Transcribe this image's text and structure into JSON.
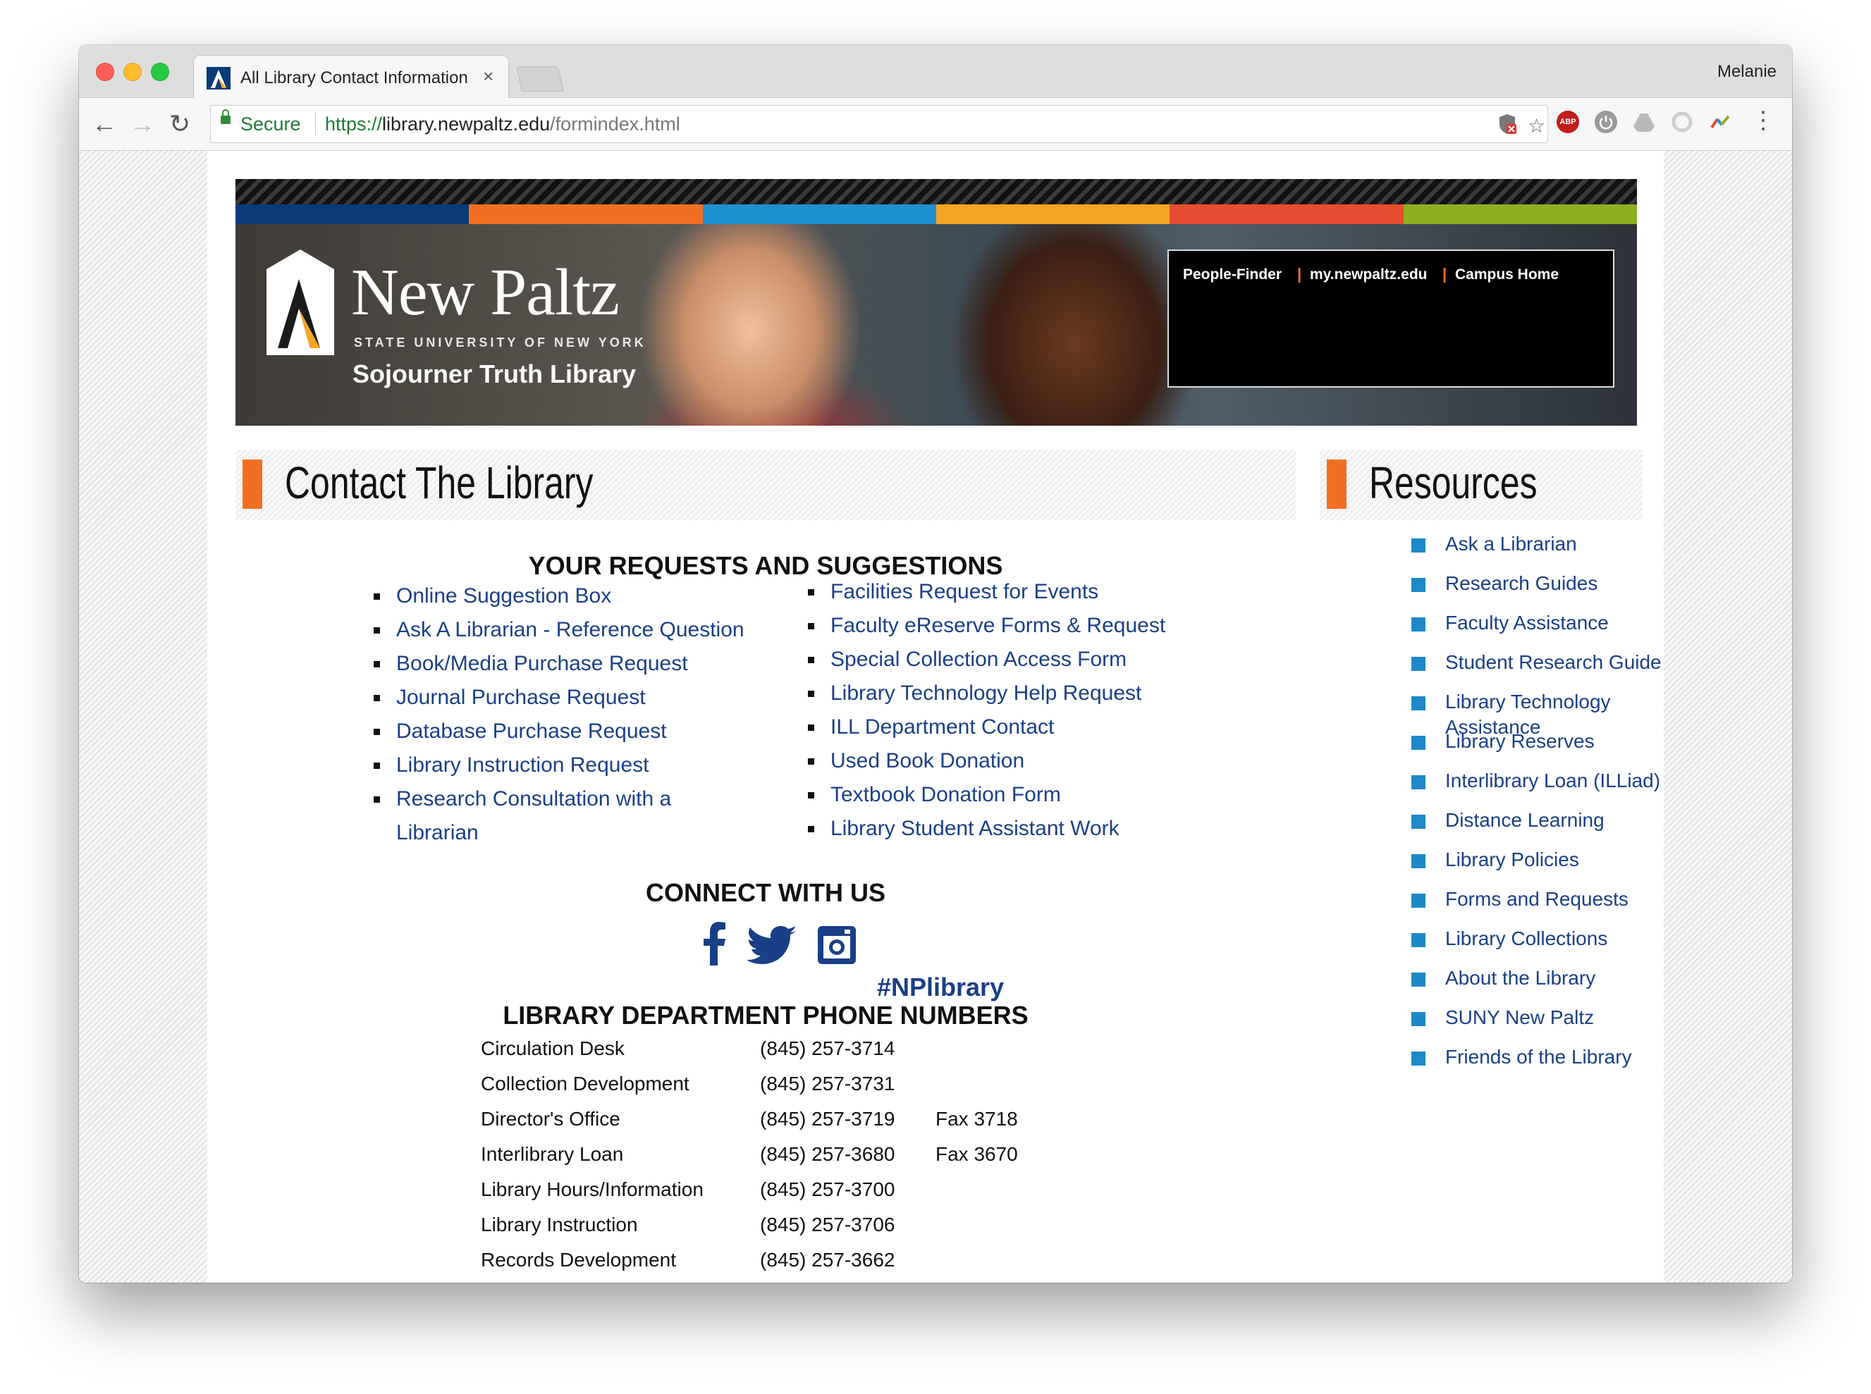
{
  "browser": {
    "tab_title": "All Library Contact Information",
    "tab_close": "×",
    "profile_name": "Melanie",
    "secure_label": "Secure",
    "url_scheme": "https://",
    "url_host": "library.newpaltz.edu",
    "url_path": "/formindex.html",
    "extensions": [
      "adblock-plus-icon",
      "power-icon",
      "drive-icon",
      "sync-icon",
      "color-picker-icon"
    ],
    "abp_label": "ABP"
  },
  "banner": {
    "logo_name": "New Paltz",
    "logo_sub": "STATE UNIVERSITY OF NEW YORK",
    "logo_library": "Sojourner Truth Library",
    "colors": [
      "#0b3a78",
      "#f26f21",
      "#1e90d0",
      "#f5a623",
      "#e84c30",
      "#8fb021"
    ],
    "quick_links": [
      "People-Finder",
      "my.newpaltz.edu",
      "Campus Home"
    ],
    "separator": "|"
  },
  "main": {
    "heading": "Contact The Library",
    "requests_heading": "YOUR REQUESTS AND SUGGESTIONS",
    "requests_left": [
      "Online Suggestion Box",
      "Ask A Librarian - Reference Question",
      "Book/Media Purchase Request",
      "Journal Purchase Request",
      "Database Purchase Request",
      "Library Instruction Request",
      "Research Consultation with a Librarian"
    ],
    "requests_right": [
      "Facilities Request for Events",
      "Faculty eReserve Forms & Request",
      "Special Collection Access Form",
      "Library Technology Help Request",
      "ILL Department Contact",
      "Used Book Donation",
      "Textbook Donation Form",
      "Library Student Assistant Work"
    ],
    "connect_heading": "CONNECT WITH US",
    "hashtag": "#NPlibrary",
    "phones_heading": "LIBRARY DEPARTMENT PHONE NUMBERS",
    "phones": [
      {
        "dept": "Circulation Desk",
        "number": "(845) 257-3714",
        "fax": ""
      },
      {
        "dept": "Collection Development",
        "number": "(845) 257-3731",
        "fax": ""
      },
      {
        "dept": "Director's Office",
        "number": "(845) 257-3719",
        "fax": "Fax 3718"
      },
      {
        "dept": "Interlibrary Loan",
        "number": "(845) 257-3680",
        "fax": "Fax 3670"
      },
      {
        "dept": "Library Hours/Information",
        "number": "(845) 257-3700",
        "fax": ""
      },
      {
        "dept": "Library Instruction",
        "number": "(845) 257-3706",
        "fax": ""
      },
      {
        "dept": "Records Development",
        "number": "(845) 257-3662",
        "fax": ""
      }
    ]
  },
  "sidebar": {
    "heading": "Resources",
    "items": [
      "Ask a Librarian",
      "Research Guides",
      "Faculty Assistance",
      "Student Research Guide",
      "Library Technology Assistance",
      "Library Reserves",
      "Interlibrary Loan (ILLiad)",
      "Distance Learning",
      "Library Policies",
      "Forms and Requests",
      "Library Collections",
      "About the Library",
      "SUNY New Paltz",
      "Friends of the Library"
    ]
  },
  "colors": {
    "accent_orange": "#f26f21",
    "link_blue": "#1a3f86",
    "bullet_blue": "#1e88c8",
    "secure_green": "#1e7b34"
  }
}
